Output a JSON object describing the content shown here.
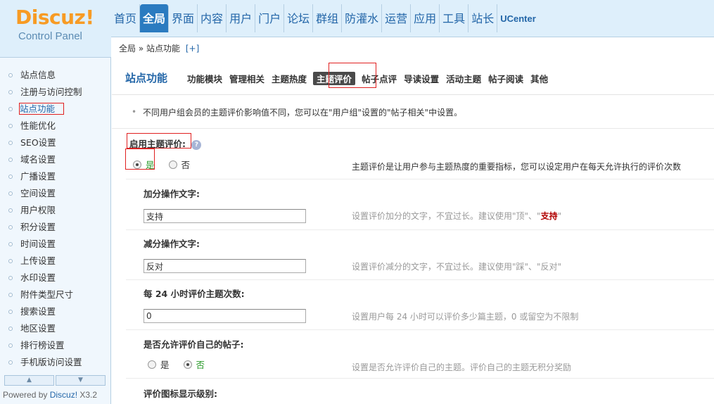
{
  "logo": {
    "brand": "Discuz!",
    "sub": "Control Panel"
  },
  "topnav": {
    "items": [
      "首页",
      "全局",
      "界面",
      "内容",
      "用户",
      "门户",
      "论坛",
      "群组",
      "防灌水",
      "运营",
      "应用",
      "工具",
      "站长",
      "UCenter"
    ],
    "active_index": 1
  },
  "breadcrumb": {
    "root": "全局",
    "sep": "»",
    "current": "站点功能",
    "plus": "[+]"
  },
  "sidebar": {
    "items": [
      "站点信息",
      "注册与访问控制",
      "站点功能",
      "性能优化",
      "SEO设置",
      "域名设置",
      "广播设置",
      "空间设置",
      "用户权限",
      "积分设置",
      "时间设置",
      "上传设置",
      "水印设置",
      "附件类型尺寸",
      "搜索设置",
      "地区设置",
      "排行榜设置",
      "手机版访问设置"
    ],
    "active_index": 2,
    "scroll_up": "▲",
    "scroll_down": "▼",
    "powered_prefix": "Powered by ",
    "powered_brand": "Discuz!",
    "powered_version": " X3.2"
  },
  "subnav": {
    "title": "站点功能",
    "tabs": [
      "功能模块",
      "管理相关",
      "主题热度",
      "主题评价",
      "帖子点评",
      "导读设置",
      "活动主题",
      "帖子阅读",
      "其他"
    ],
    "active_index": 3
  },
  "tip": {
    "bullet": "•",
    "text": "不同用户组会员的主题评价影响值不同，您可以在\"用户组\"设置的\"帖子相关\"中设置。"
  },
  "settings": {
    "enable": {
      "label": "启用主题评价:",
      "help": "?",
      "yes": "是",
      "no": "否",
      "selected": "yes",
      "desc": "主题评价是让用户参与主题热度的重要指标，您可以设定用户在每天允许执行的评价次数"
    },
    "plus_text": {
      "label": "加分操作文字:",
      "value": "支持",
      "desc_prefix": "设置评价加分的文字，不宜过长。建议使用\"顶\"、\"",
      "desc_em": "支持",
      "desc_suffix": "\""
    },
    "minus_text": {
      "label": "减分操作文字:",
      "value": "反对",
      "desc": "设置评价减分的文字，不宜过长。建议使用\"踩\"、\"反对\""
    },
    "daily_limit": {
      "label": "每 24 小时评价主题次数:",
      "value": "0",
      "desc": "设置用户每 24 小时可以评价多少篇主题，0 或留空为不限制"
    },
    "self_rate": {
      "label": "是否允许评价自己的帖子:",
      "yes": "是",
      "no": "否",
      "selected": "no",
      "desc": "设置是否允许评价自己的主题。评价自己的主题无积分奖励"
    },
    "icon_level": {
      "label": "评价图标显示级别:"
    }
  }
}
